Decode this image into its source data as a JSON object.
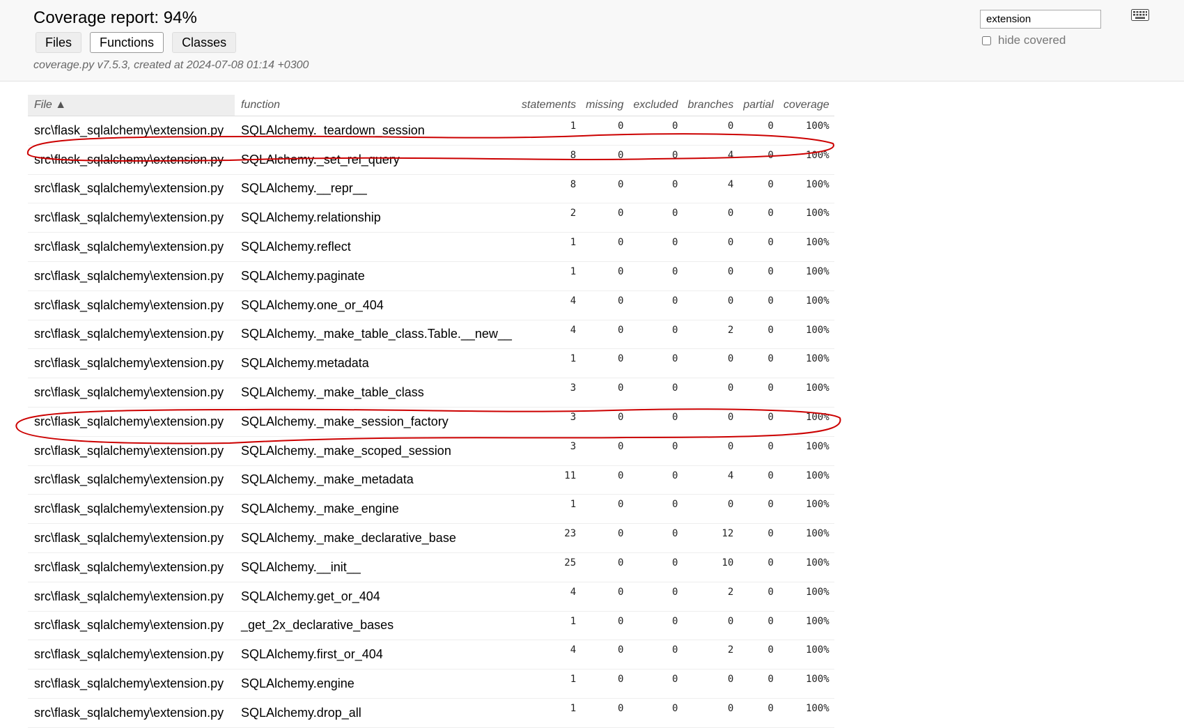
{
  "header": {
    "title": "Coverage report: 94%",
    "tabs": [
      "Files",
      "Functions",
      "Classes"
    ],
    "active_tab": "Functions",
    "meta": "coverage.py v7.5.3, created at 2024-07-08 01:14 +0300",
    "filter_value": "extension",
    "hide_covered_label": "hide covered",
    "keyboard_icon": "keyboard-icon"
  },
  "table": {
    "columns": [
      "File ▲",
      "function",
      "statements",
      "missing",
      "excluded",
      "branches",
      "partial",
      "coverage"
    ],
    "rows": [
      [
        "src\\flask_sqlalchemy\\extension.py",
        "SQLAlchemy._teardown_session",
        "1",
        "0",
        "0",
        "0",
        "0",
        "100%"
      ],
      [
        "src\\flask_sqlalchemy\\extension.py",
        "SQLAlchemy._set_rel_query",
        "8",
        "0",
        "0",
        "4",
        "0",
        "100%"
      ],
      [
        "src\\flask_sqlalchemy\\extension.py",
        "SQLAlchemy.__repr__",
        "8",
        "0",
        "0",
        "4",
        "0",
        "100%"
      ],
      [
        "src\\flask_sqlalchemy\\extension.py",
        "SQLAlchemy.relationship",
        "2",
        "0",
        "0",
        "0",
        "0",
        "100%"
      ],
      [
        "src\\flask_sqlalchemy\\extension.py",
        "SQLAlchemy.reflect",
        "1",
        "0",
        "0",
        "0",
        "0",
        "100%"
      ],
      [
        "src\\flask_sqlalchemy\\extension.py",
        "SQLAlchemy.paginate",
        "1",
        "0",
        "0",
        "0",
        "0",
        "100%"
      ],
      [
        "src\\flask_sqlalchemy\\extension.py",
        "SQLAlchemy.one_or_404",
        "4",
        "0",
        "0",
        "0",
        "0",
        "100%"
      ],
      [
        "src\\flask_sqlalchemy\\extension.py",
        "SQLAlchemy._make_table_class.Table.__new__",
        "4",
        "0",
        "0",
        "2",
        "0",
        "100%"
      ],
      [
        "src\\flask_sqlalchemy\\extension.py",
        "SQLAlchemy.metadata",
        "1",
        "0",
        "0",
        "0",
        "0",
        "100%"
      ],
      [
        "src\\flask_sqlalchemy\\extension.py",
        "SQLAlchemy._make_table_class",
        "3",
        "0",
        "0",
        "0",
        "0",
        "100%"
      ],
      [
        "src\\flask_sqlalchemy\\extension.py",
        "SQLAlchemy._make_session_factory",
        "3",
        "0",
        "0",
        "0",
        "0",
        "100%"
      ],
      [
        "src\\flask_sqlalchemy\\extension.py",
        "SQLAlchemy._make_scoped_session",
        "3",
        "0",
        "0",
        "0",
        "0",
        "100%"
      ],
      [
        "src\\flask_sqlalchemy\\extension.py",
        "SQLAlchemy._make_metadata",
        "11",
        "0",
        "0",
        "4",
        "0",
        "100%"
      ],
      [
        "src\\flask_sqlalchemy\\extension.py",
        "SQLAlchemy._make_engine",
        "1",
        "0",
        "0",
        "0",
        "0",
        "100%"
      ],
      [
        "src\\flask_sqlalchemy\\extension.py",
        "SQLAlchemy._make_declarative_base",
        "23",
        "0",
        "0",
        "12",
        "0",
        "100%"
      ],
      [
        "src\\flask_sqlalchemy\\extension.py",
        "SQLAlchemy.__init__",
        "25",
        "0",
        "0",
        "10",
        "0",
        "100%"
      ],
      [
        "src\\flask_sqlalchemy\\extension.py",
        "SQLAlchemy.get_or_404",
        "4",
        "0",
        "0",
        "2",
        "0",
        "100%"
      ],
      [
        "src\\flask_sqlalchemy\\extension.py",
        "_get_2x_declarative_bases",
        "1",
        "0",
        "0",
        "0",
        "0",
        "100%"
      ],
      [
        "src\\flask_sqlalchemy\\extension.py",
        "SQLAlchemy.first_or_404",
        "4",
        "0",
        "0",
        "2",
        "0",
        "100%"
      ],
      [
        "src\\flask_sqlalchemy\\extension.py",
        "SQLAlchemy.engine",
        "1",
        "0",
        "0",
        "0",
        "0",
        "100%"
      ],
      [
        "src\\flask_sqlalchemy\\extension.py",
        "SQLAlchemy.drop_all",
        "1",
        "0",
        "0",
        "0",
        "0",
        "100%"
      ]
    ]
  },
  "annotation_color": "#cc0000"
}
